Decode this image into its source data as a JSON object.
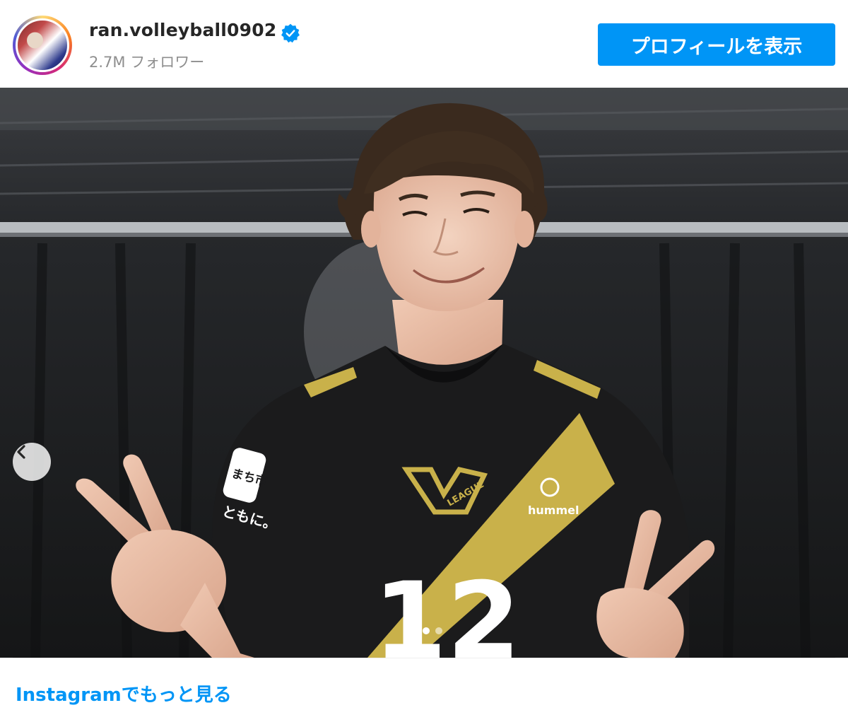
{
  "header": {
    "username": "ran.volleyball0902",
    "followers": "2.7M フォロワー",
    "profile_button": "プロフィールを表示"
  },
  "photo": {
    "jersey_number": "12",
    "jersey_brand": "hummel",
    "jersey_league": "LEAGUE",
    "sleeve_sponsor": "まち市",
    "sleeve_text": "ともに。"
  },
  "carousel": {
    "current_index": 1,
    "total": 3
  },
  "footer": {
    "more_link": "Instagramでもっと見る"
  },
  "colors": {
    "accent": "#0095f6",
    "jersey_gold": "#c9b14a",
    "jersey_black": "#1b1b1c"
  },
  "icons": {
    "verified": "verified-badge-icon",
    "prev": "chevron-left-icon"
  }
}
